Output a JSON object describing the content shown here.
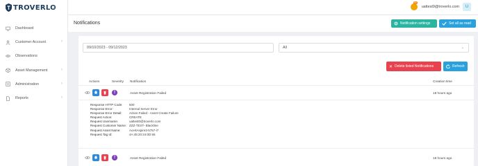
{
  "app": {
    "logo_text": "TROVERLO",
    "collapse_icon": "chevron-left-icon"
  },
  "sidebar": {
    "items": [
      {
        "label": "Dashboard",
        "icon": "monitor-icon",
        "has_children": false
      },
      {
        "label": "Customer Account",
        "icon": "user-icon",
        "has_children": true
      },
      {
        "label": "Observations",
        "icon": "eye-icon",
        "has_children": false
      },
      {
        "label": "Asset Management",
        "icon": "box-icon",
        "has_children": true
      },
      {
        "label": "Administration",
        "icon": "admin-icon",
        "has_children": true
      },
      {
        "label": "Reports",
        "icon": "file-icon",
        "has_children": true
      }
    ]
  },
  "topbar": {
    "user_email": "uattest9@troverlo.com",
    "avatar_letter": "U",
    "bell_badge": "99"
  },
  "header": {
    "title": "Notifications",
    "settings_label": "Notification settings",
    "mark_read_label": "Set all as read"
  },
  "filters": {
    "date_range": "09/10/2023 - 09/12/2023",
    "select_value": "All"
  },
  "actions": {
    "delete_label": "Delete listed Notifications",
    "refresh_label": "Refresh"
  },
  "table": {
    "headers": {
      "actions": "Actions",
      "severity": "Severity",
      "notification": "Notification",
      "creation_time": "Creation time"
    },
    "rows": [
      {
        "notification": "Asset Registration Failed",
        "time": "18 hours ago"
      },
      {
        "notification": "Asset Registration Failed",
        "time": "18 hours ago"
      }
    ],
    "details": [
      {
        "key": "Response HTTP Code:",
        "value": "500"
      },
      {
        "key": "Response Error:",
        "value": "Internal Server Error"
      },
      {
        "key": "Response Error Detail:",
        "value": "Action Failed - Asset Create Failure"
      },
      {
        "key": "Request Action:",
        "value": "CREATE"
      },
      {
        "key": "Request Username:",
        "value": "uattest0@troverlo.com"
      },
      {
        "key": "Request Customer Name:",
        "value": "ZZZ-TEST- Blackline"
      },
      {
        "key": "Request Asset Name:",
        "value": "AcertAspire3-5757-i7"
      },
      {
        "key": "Request Tag Id:",
        "value": "4A:45:20:24:0D:65"
      }
    ]
  }
}
